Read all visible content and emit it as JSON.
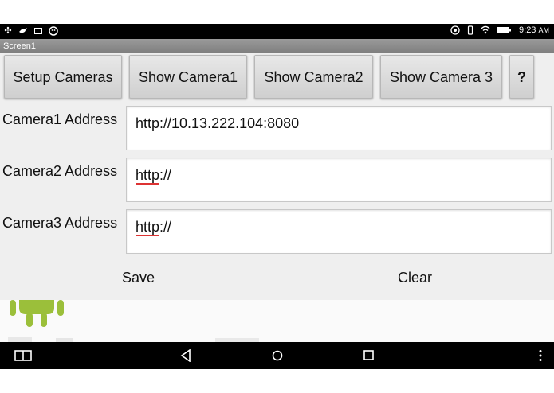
{
  "status_bar": {
    "time": "9:23",
    "ampm": "AM"
  },
  "title_bar": {
    "title": "Screen1"
  },
  "buttons": {
    "setup": "Setup Cameras",
    "show1": "Show Camera1",
    "show2": "Show Camera2",
    "show3": "Show Camera 3",
    "help": "?"
  },
  "cameras": [
    {
      "label": "Camera1 Address",
      "value": "http://10.13.222.104:8080"
    },
    {
      "label": "Camera2 Address",
      "value_underlined": "http",
      "value_rest": "://"
    },
    {
      "label": "Camera3 Address",
      "value_underlined": "http",
      "value_rest": "://"
    }
  ],
  "actions": {
    "save": "Save",
    "clear": "Clear"
  },
  "icons": {
    "status_left": [
      "notification-icon",
      "bird-icon",
      "image-icon",
      "face-icon"
    ],
    "status_right": [
      "target-icon",
      "vibrate-icon",
      "wifi-icon",
      "battery-icon"
    ],
    "nav": [
      "recent-apps-icon",
      "back-icon",
      "home-icon",
      "overview-icon",
      "menu-icon"
    ]
  }
}
